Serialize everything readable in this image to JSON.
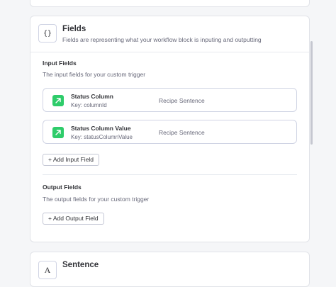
{
  "fields_card": {
    "icon": "{}",
    "title": "Fields",
    "subtitle": "Fields are representing what your workflow block is inputing and outputting"
  },
  "input": {
    "title": "Input Fields",
    "description": "The input fields for your custom trigger",
    "items": [
      {
        "name": "Status Column",
        "key": "Key: columnId",
        "type": "Recipe Sentence",
        "icon": "arrow-up-right-icon"
      },
      {
        "name": "Status Column Value",
        "key": "Key: statusColumnValue",
        "type": "Recipe Sentence",
        "icon": "arrow-up-right-icon"
      }
    ],
    "add_button": "+ Add Input Field"
  },
  "output": {
    "title": "Output Fields",
    "description": "The output fields for your custom trigger",
    "add_button": "+ Add Output Field"
  },
  "sentence_card": {
    "icon": "A",
    "title": "Sentence"
  },
  "colors": {
    "accent_green": "#2ecc6a",
    "border": "#d0d4e4",
    "muted_text": "#676879"
  }
}
